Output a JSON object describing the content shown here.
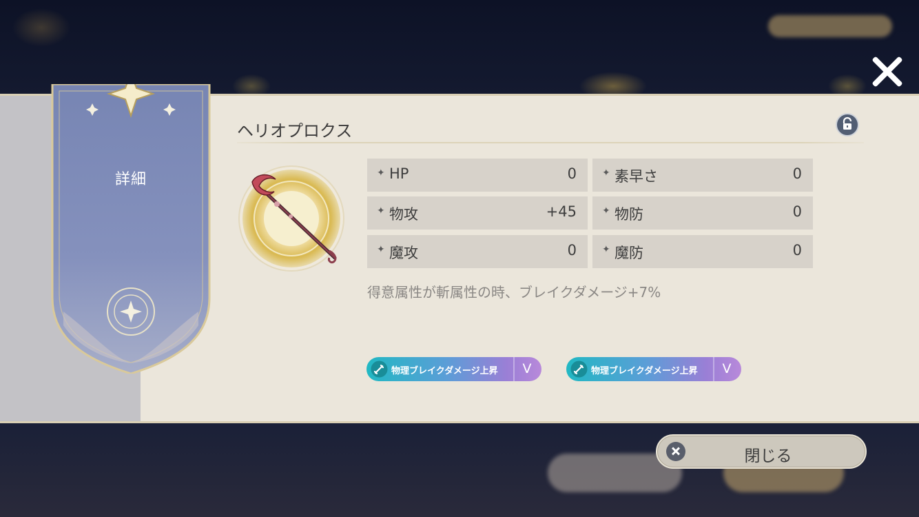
{
  "banner": {
    "label": "詳細"
  },
  "item": {
    "name": "ヘリオプロクス",
    "description": "得意属性が斬属性の時、ブレイクダメージ+7%"
  },
  "stats": [
    {
      "label": "HP",
      "value": "0"
    },
    {
      "label": "素早さ",
      "value": "0"
    },
    {
      "label": "物攻",
      "value": "+45"
    },
    {
      "label": "物防",
      "value": "0"
    },
    {
      "label": "魔攻",
      "value": "0"
    },
    {
      "label": "魔防",
      "value": "0"
    }
  ],
  "skills": [
    {
      "label": "物理ブレイクダメージ上昇",
      "level": "V"
    },
    {
      "label": "物理ブレイクダメージ上昇",
      "level": "V"
    }
  ],
  "actions": {
    "close_label": "閉じる"
  },
  "icons": {
    "close": "close-icon",
    "lock": "unlock-icon",
    "weapon": "scythe-staff-icon",
    "skill": "sword-skill-icon",
    "star": "✦"
  },
  "colors": {
    "panel": "#ebe6db",
    "banner": "#7e8cb4",
    "stat_cell": "#d7d2ca",
    "badge_start": "#21b8c3",
    "badge_end": "#b889da"
  }
}
